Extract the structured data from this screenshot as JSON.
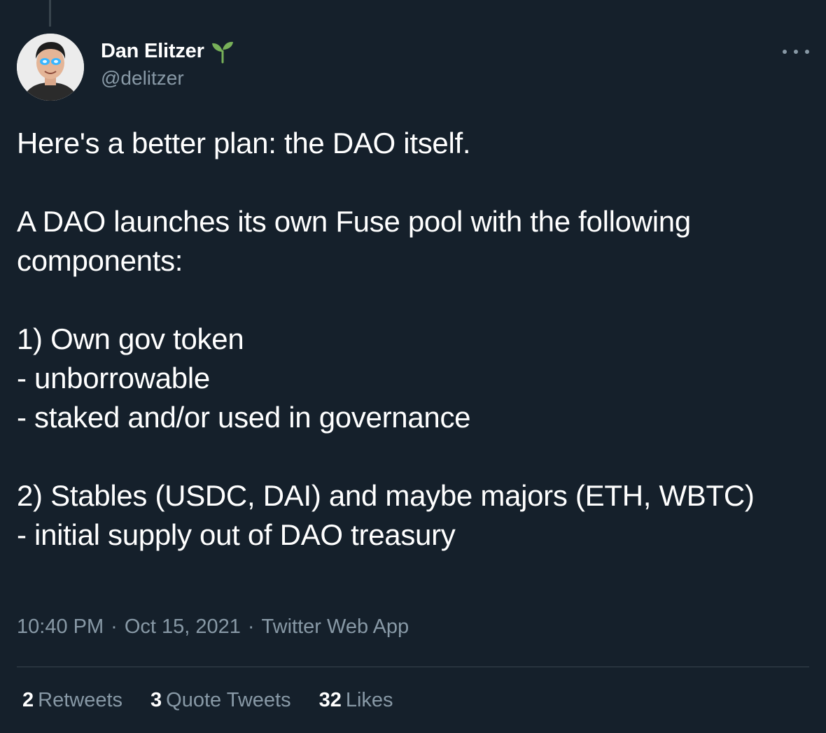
{
  "author": {
    "display_name": "Dan Elitzer",
    "handle": "@delitzer",
    "name_emoji_icon": "sprout-icon",
    "avatar_icon": "profile-photo"
  },
  "menu": {
    "more_icon": "ellipsis-icon"
  },
  "tweet": {
    "paragraphs": [
      "Here's a better plan: the DAO itself.",
      "A DAO launches its own Fuse pool with the following components:",
      "1) Own gov token\n- unborrowable\n- staked and/or used in governance",
      "2) Stables (USDC, DAI) and maybe majors (ETH, WBTC)\n- initial supply out of DAO treasury"
    ]
  },
  "meta": {
    "time": "10:40 PM",
    "separator": "·",
    "date": "Oct 15, 2021",
    "source": "Twitter Web App"
  },
  "stats": [
    {
      "count": "2",
      "label": "Retweets"
    },
    {
      "count": "3",
      "label": "Quote Tweets"
    },
    {
      "count": "32",
      "label": "Likes"
    }
  ],
  "colors": {
    "background": "#15202b",
    "secondary_text": "#8899a6",
    "divider": "#38444d",
    "sprout_green": "#78b159"
  }
}
